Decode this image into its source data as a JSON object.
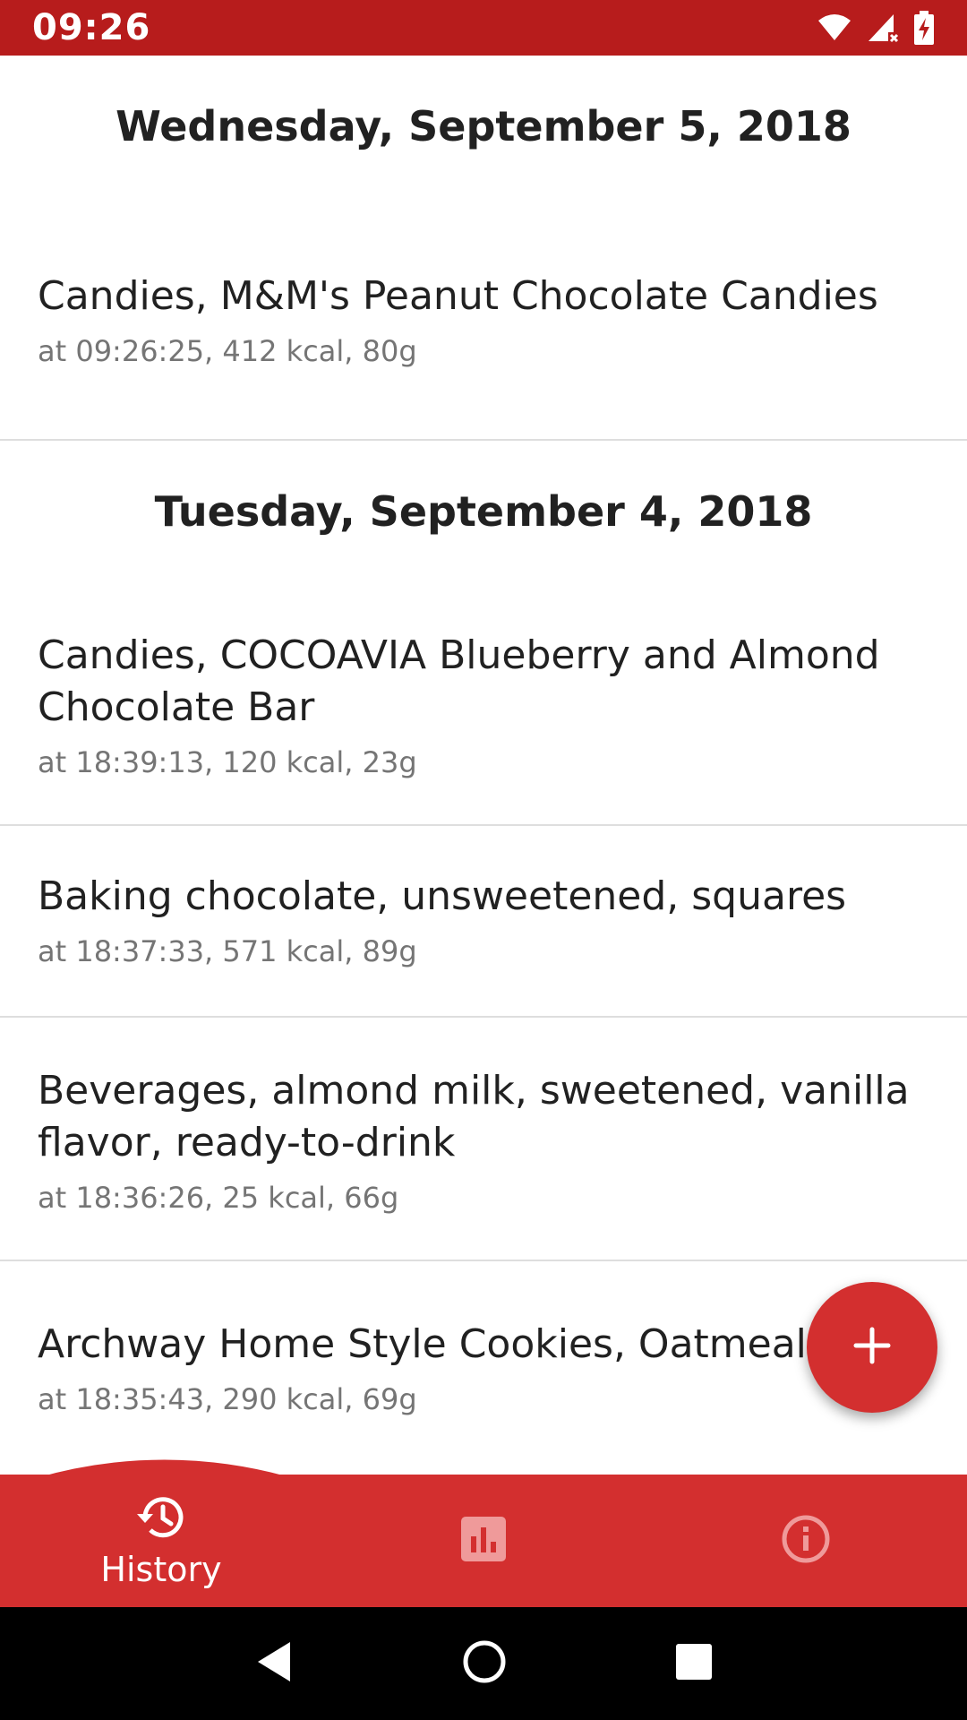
{
  "status_bar": {
    "time": "09:26",
    "icons": [
      "wifi-icon",
      "cell-signal-icon",
      "battery-charging-icon"
    ]
  },
  "history": {
    "days": [
      {
        "date": "Wednesday, September 5, 2018",
        "entries": [
          {
            "name": "Candies, M&M's Peanut Chocolate Candies",
            "details": "at 09:26:25, 412 kcal, 80g"
          }
        ]
      },
      {
        "date": "Tuesday, September 4, 2018",
        "entries": [
          {
            "name": "Candies, COCOAVIA Blueberry and Almond Chocolate Bar",
            "details": "at 18:39:13, 120 kcal, 23g"
          },
          {
            "name": "Baking chocolate, unsweetened, squares",
            "details": "at 18:37:33, 571 kcal, 89g"
          },
          {
            "name": "Beverages, almond milk, sweetened, vanilla flavor, ready-to-drink",
            "details": "at 18:36:26, 25 kcal, 66g"
          },
          {
            "name": "Archway Home Style Cookies, Oatmeal",
            "details": "at 18:35:43, 290 kcal, 69g"
          }
        ]
      }
    ]
  },
  "fab": {
    "icon": "plus-icon"
  },
  "bottom_nav": {
    "items": [
      {
        "label": "History",
        "icon": "history-icon",
        "active": true
      },
      {
        "label": "",
        "icon": "bar-chart-icon",
        "active": false
      },
      {
        "label": "",
        "icon": "info-icon",
        "active": false
      }
    ]
  },
  "system_nav": {
    "icons": [
      "back-icon",
      "home-icon",
      "recents-icon"
    ]
  },
  "colors": {
    "status_bar": "#b71c1c",
    "primary": "#d32f2f",
    "text_primary": "#212121",
    "text_secondary": "#757575",
    "divider": "#dedede"
  }
}
